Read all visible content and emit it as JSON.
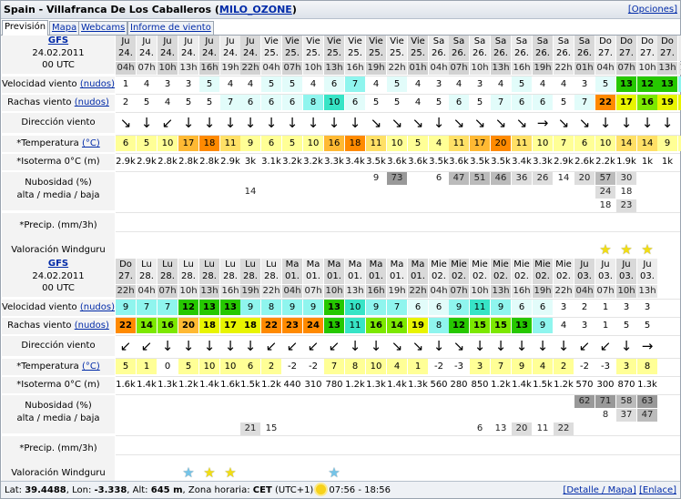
{
  "header": {
    "title": "Spain - Villafranca De Los Caballeros",
    "paren_open": "(",
    "paren_close": ")",
    "link": "MILO_OZONE",
    "options": "[Opciones]"
  },
  "tabs": [
    "Previsión",
    "Mapa",
    "Webcams",
    "Informe de viento"
  ],
  "labels": {
    "model": "GFS",
    "date": "24.02.2011",
    "init": "00 UTC",
    "wind_speed": "Velocidad viento",
    "units": "(nudos)",
    "gusts": "Rachas viento",
    "direction": "Dirección viento",
    "temp": "*Temperatura",
    "temp_unit": "(°C)",
    "isotherm": "*Isoterma 0°C (m)",
    "cloud1": "Nubosidad (%)",
    "cloud2": "alta / media / baja",
    "precip": "*Precip. (mm/3h)",
    "rating": "Valoración Windguru"
  },
  "colors": {
    "speed_scale": [
      "#ffffff",
      "#ffffff",
      "#e2fcfa",
      "#8ff5ee",
      "#37e4c6",
      "#26c800",
      "#7ce800"
    ],
    "temp_scale": [
      "#ffffff",
      "#ffff96",
      "#ffe066",
      "#ffb933",
      "#ff8a00"
    ],
    "cloud_scale": [
      "#ffffff",
      "#dddddd",
      "#bbbbbb",
      "#999999",
      "#777777"
    ],
    "star_yellow": "#f2de12",
    "star_blue": "#74c4e8"
  },
  "block1": {
    "days": [
      "Ju",
      "Ju",
      "Ju",
      "Ju",
      "Ju",
      "Ju",
      "Ju",
      "Vie",
      "Vie",
      "Vie",
      "Vie",
      "Vie",
      "Vie",
      "Vie",
      "Vie",
      "Sa",
      "Sa",
      "Sa",
      "Sa",
      "Sa",
      "Sa",
      "Sa",
      "Sa",
      "Do",
      "Do",
      "Do",
      "Do",
      "Do"
    ],
    "dates": [
      "24.",
      "24.",
      "24.",
      "24.",
      "24.",
      "24.",
      "24.",
      "25.",
      "25.",
      "25.",
      "25.",
      "25.",
      "25.",
      "25.",
      "25.",
      "26.",
      "26.",
      "26.",
      "26.",
      "26.",
      "26.",
      "26.",
      "26.",
      "27.",
      "27.",
      "27.",
      "27.",
      "27."
    ],
    "hours": [
      "04h",
      "07h",
      "10h",
      "13h",
      "16h",
      "19h",
      "22h",
      "04h",
      "07h",
      "10h",
      "13h",
      "16h",
      "19h",
      "22h",
      "01h",
      "04h",
      "07h",
      "10h",
      "13h",
      "16h",
      "19h",
      "22h",
      "01h",
      "04h",
      "07h",
      "10h",
      "13h",
      "16h"
    ],
    "speed": [
      "1",
      "4",
      "3",
      "3",
      "5",
      "4",
      "4",
      "5",
      "5",
      "4",
      "6",
      "7",
      "4",
      "5",
      "4",
      "3",
      "4",
      "3",
      "4",
      "5",
      "4",
      "4",
      "3",
      "5",
      "13",
      "12",
      "13",
      "9"
    ],
    "gusts": [
      "2",
      "5",
      "4",
      "5",
      "5",
      "7",
      "6",
      "6",
      "6",
      "8",
      "10",
      "6",
      "5",
      "5",
      "4",
      "5",
      "6",
      "5",
      "7",
      "6",
      "6",
      "5",
      "7",
      "22",
      "17",
      "16",
      "19",
      "19"
    ],
    "dir": [
      "↘",
      "↓",
      "↙",
      "↓",
      "↓",
      "↓",
      "↓",
      "↓",
      "↓",
      "↓",
      "↓",
      "↓",
      "↘",
      "↘",
      "↘",
      "↓",
      "↘",
      "↘",
      "↘",
      "↘",
      "→",
      "↘",
      "↘",
      "↓",
      "↓",
      "↓",
      "↓",
      "↓"
    ],
    "temp": [
      "6",
      "5",
      "10",
      "17",
      "18",
      "11",
      "9",
      "6",
      "5",
      "10",
      "16",
      "18",
      "11",
      "10",
      "5",
      "4",
      "11",
      "17",
      "20",
      "11",
      "10",
      "7",
      "6",
      "10",
      "14",
      "14",
      "9",
      "9"
    ],
    "isotherm": [
      "2.9k",
      "2.9k",
      "2.8k",
      "2.8k",
      "2.8k",
      "2.9k",
      "3k",
      "3.1k",
      "3.2k",
      "3.2k",
      "3.3k",
      "3.4k",
      "3.5k",
      "3.6k",
      "3.6k",
      "3.5k",
      "3.6k",
      "3.5k",
      "3.5k",
      "3.4k",
      "3.3k",
      "2.9k",
      "2.6k",
      "2.2k",
      "1.9k",
      "1k",
      "1k",
      "1k"
    ],
    "cloud_high": [
      "",
      "",
      "",
      "",
      "",
      "",
      "",
      "",
      "",
      "",
      "",
      "",
      "9",
      "73",
      "",
      "6",
      "47",
      "51",
      "46",
      "36",
      "26",
      "14",
      "20",
      "57",
      "30",
      "",
      "",
      ""
    ],
    "cloud_mid": [
      "",
      "",
      "",
      "",
      "",
      "",
      "14",
      "",
      "",
      "",
      "",
      "",
      "",
      "",
      "",
      "",
      "",
      "",
      "",
      "",
      "",
      "",
      "",
      "24",
      "18",
      "",
      "",
      ""
    ],
    "cloud_low": [
      "",
      "",
      "",
      "",
      "",
      "",
      "",
      "",
      "",
      "",
      "",
      "",
      "",
      "",
      "",
      "",
      "",
      "",
      "",
      "",
      "",
      "",
      "",
      "18",
      "23",
      "",
      "",
      ""
    ],
    "precip": [
      "",
      "",
      "",
      "",
      "",
      "",
      "",
      "",
      "",
      "",
      "",
      "",
      "",
      "",
      "",
      "",
      "",
      "",
      "",
      "",
      "",
      "",
      "",
      "",
      "",
      "",
      "",
      ""
    ],
    "stars": [
      "",
      "",
      "",
      "",
      "",
      "",
      "",
      "",
      "",
      "",
      "",
      "",
      "",
      "",
      "",
      "",
      "",
      "",
      "",
      "",
      "",
      "",
      "",
      "y",
      "y",
      "y",
      "",
      ""
    ]
  },
  "block2": {
    "days": [
      "Do",
      "Lu",
      "Lu",
      "Lu",
      "Lu",
      "Lu",
      "Lu",
      "Lu",
      "Ma",
      "Ma",
      "Ma",
      "Ma",
      "Ma",
      "Ma",
      "Ma",
      "Mie",
      "Mie",
      "Mie",
      "Mie",
      "Mie",
      "Mie",
      "Mie",
      "Ju",
      "Ju",
      "Ju",
      "Ju"
    ],
    "dates": [
      "27.",
      "28.",
      "28.",
      "28.",
      "28.",
      "28.",
      "28.",
      "28.",
      "01.",
      "01.",
      "01.",
      "01.",
      "01.",
      "01.",
      "01.",
      "02.",
      "02.",
      "02.",
      "02.",
      "02.",
      "02.",
      "02.",
      "03.",
      "03.",
      "03.",
      "03."
    ],
    "hours": [
      "22h",
      "04h",
      "07h",
      "10h",
      "13h",
      "16h",
      "19h",
      "22h",
      "04h",
      "07h",
      "10h",
      "13h",
      "16h",
      "19h",
      "22h",
      "04h",
      "07h",
      "10h",
      "13h",
      "16h",
      "19h",
      "22h",
      "04h",
      "07h",
      "10h",
      "13h"
    ],
    "speed": [
      "9",
      "7",
      "7",
      "12",
      "13",
      "13",
      "9",
      "8",
      "9",
      "9",
      "13",
      "10",
      "9",
      "7",
      "6",
      "6",
      "9",
      "11",
      "9",
      "6",
      "6",
      "3",
      "2",
      "1",
      "3",
      "3"
    ],
    "gusts": [
      "22",
      "14",
      "16",
      "20",
      "18",
      "17",
      "18",
      "22",
      "23",
      "24",
      "13",
      "11",
      "16",
      "14",
      "19",
      "8",
      "12",
      "15",
      "15",
      "13",
      "9",
      "4",
      "3",
      "1",
      "5",
      "5"
    ],
    "dir": [
      "↙",
      "↙",
      "↓",
      "↓",
      "↓",
      "↓",
      "↓",
      "↙",
      "↙",
      "↙",
      "↙",
      "↓",
      "↓",
      "↘",
      "↘",
      "↓",
      "↘",
      "↓",
      "↓",
      "↓",
      "↓",
      "↓",
      "↙",
      "↙",
      "↓",
      "→"
    ],
    "temp": [
      "5",
      "1",
      "0",
      "5",
      "10",
      "10",
      "6",
      "2",
      "-2",
      "-2",
      "7",
      "8",
      "10",
      "4",
      "1",
      "-2",
      "-3",
      "3",
      "7",
      "9",
      "4",
      "2",
      "-2",
      "-3",
      "3",
      "8"
    ],
    "isotherm": [
      "1.6k",
      "1.4k",
      "1.3k",
      "1.2k",
      "1.4k",
      "1.6k",
      "1.5k",
      "1.2k",
      "440",
      "310",
      "780",
      "1.2k",
      "1.3k",
      "1.4k",
      "1.3k",
      "560",
      "280",
      "850",
      "1.2k",
      "1.4k",
      "1.5k",
      "1.2k",
      "570",
      "300",
      "870",
      "1.3k"
    ],
    "cloud_high": [
      "",
      "",
      "",
      "",
      "",
      "",
      "",
      "",
      "",
      "",
      "",
      "",
      "",
      "",
      "",
      "",
      "",
      "",
      "",
      "",
      "",
      "",
      "62",
      "71",
      "58",
      "63"
    ],
    "cloud_mid": [
      "",
      "",
      "",
      "",
      "",
      "",
      "",
      "",
      "",
      "",
      "",
      "",
      "",
      "",
      "",
      "",
      "",
      "",
      "",
      "",
      "",
      "",
      "",
      "8",
      "37",
      "47"
    ],
    "cloud_low": [
      "",
      "",
      "",
      "",
      "",
      "",
      "21",
      "15",
      "",
      "",
      "",
      "",
      "",
      "",
      "",
      "",
      "",
      "6",
      "13",
      "20",
      "11",
      "22",
      "",
      "",
      "",
      ""
    ],
    "precip": [
      "",
      "",
      "",
      "",
      "",
      "",
      "",
      "",
      "",
      "",
      "",
      "",
      "",
      "",
      "",
      "",
      "",
      "",
      "",
      "",
      "",
      "",
      "",
      "",
      "",
      ""
    ],
    "stars": [
      "",
      "",
      "",
      "b",
      "y",
      "y",
      "",
      "",
      "",
      "",
      "b",
      "",
      "",
      "",
      "",
      "",
      "",
      "",
      "",
      "",
      "",
      "",
      "",
      "",
      "",
      ""
    ]
  },
  "footer": {
    "lat_label": "Lat:",
    "lat": "39.4488",
    "lon_label": ", Lon:",
    "lon": "-3.338",
    "alt_label": ", Alt:",
    "alt": "645 m",
    "tz_label": ", Zona horaria:",
    "tz": "CET",
    "tz_offset": "(UTC+1)",
    "sun": "07:56 - 18:56",
    "detail_link": "[Detalle / Mapa]",
    "embed_link": "[Enlace]"
  }
}
